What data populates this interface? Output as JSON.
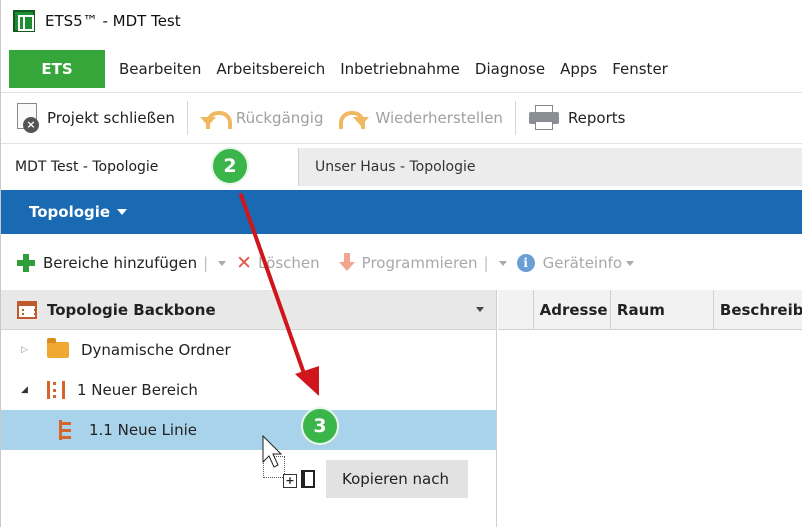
{
  "window": {
    "title": "ETS5™ - MDT Test"
  },
  "menu": {
    "ets": "ETS",
    "items": [
      "Bearbeiten",
      "Arbeitsbereich",
      "Inbetriebnahme",
      "Diagnose",
      "Apps",
      "Fenster"
    ]
  },
  "toolbar": {
    "close_project": "Projekt schließen",
    "undo": "Rückgängig",
    "redo": "Wiederherstellen",
    "reports": "Reports"
  },
  "doctabs": {
    "active": "MDT Test - Topologie",
    "close": "×",
    "inactive": "Unser Haus - Topologie"
  },
  "panel_header": {
    "title": "Topologie"
  },
  "actionbar": {
    "add_areas": "Bereiche hinzufügen",
    "delete": "Löschen",
    "program": "Programmieren",
    "device_info": "Geräteinfo"
  },
  "tree": {
    "header": "Topologie Backbone",
    "items": [
      {
        "label": "Dynamische Ordner"
      },
      {
        "label": "1 Neuer Bereich"
      },
      {
        "label": "1.1 Neue Linie"
      }
    ]
  },
  "table": {
    "columns": [
      "Adresse",
      "Raum",
      "Beschreibung"
    ]
  },
  "badges": {
    "step2": "2",
    "step3": "3"
  },
  "drag": {
    "tooltip": "Kopieren nach"
  },
  "colors": {
    "ets_green": "#37a63a",
    "header_blue": "#1969b3",
    "selection": "#a9d3ea",
    "badge_green": "#3ab54a",
    "arrow_red": "#d0161c"
  }
}
